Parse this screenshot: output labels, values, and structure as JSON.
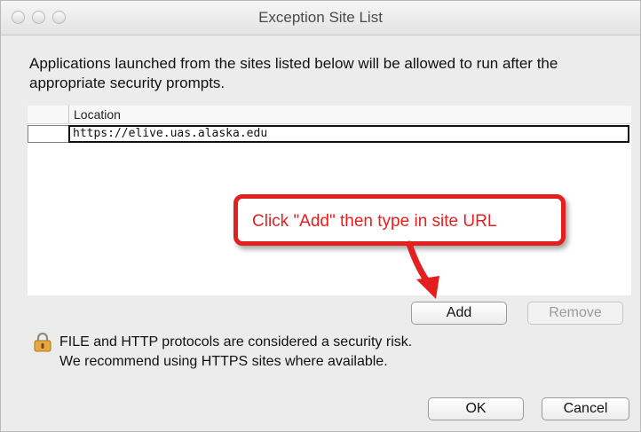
{
  "window": {
    "title": "Exception Site List"
  },
  "intro_text": "Applications launched from the sites listed below will be allowed to run after the appropriate security prompts.",
  "table": {
    "columns": [
      "Location"
    ],
    "rows": [
      {
        "location": "https://elive.uas.alaska.edu"
      }
    ]
  },
  "callout": {
    "text": "Click \"Add\" then type in site URL",
    "color": "#e41f1f"
  },
  "buttons": {
    "add": "Add",
    "remove": "Remove",
    "ok": "OK",
    "cancel": "Cancel"
  },
  "warning": {
    "line1": "FILE and HTTP protocols are considered a security risk.",
    "line2": "We recommend using HTTPS sites where available.",
    "icon": "lock-icon"
  }
}
